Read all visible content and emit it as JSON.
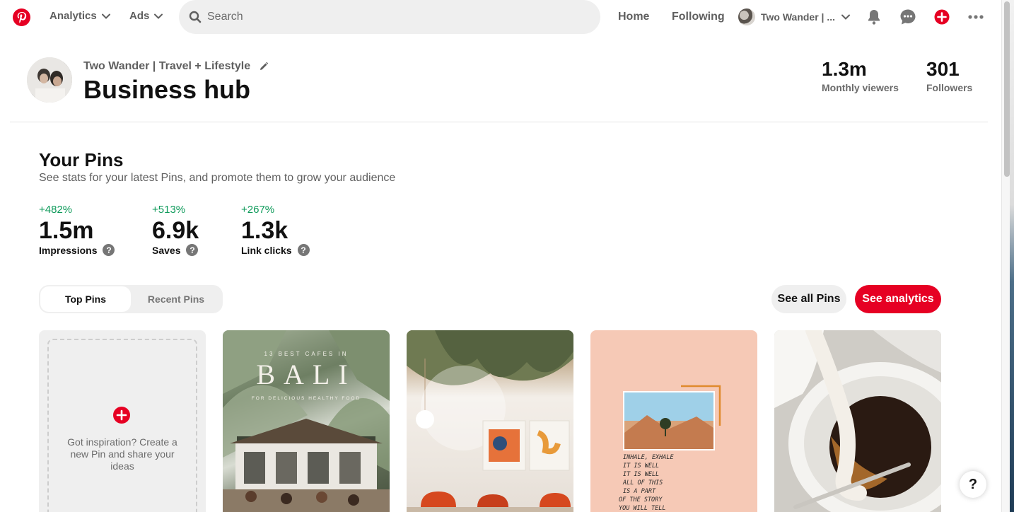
{
  "nav": {
    "analytics_label": "Analytics",
    "ads_label": "Ads",
    "search_placeholder": "Search",
    "home_label": "Home",
    "following_label": "Following",
    "account_label": "Two Wander | ..."
  },
  "header": {
    "profile_name": "Two Wander | Travel + Lifestyle",
    "title": "Business hub",
    "monthly_viewers_value": "1.3m",
    "monthly_viewers_label": "Monthly viewers",
    "followers_value": "301",
    "followers_label": "Followers"
  },
  "your_pins": {
    "title": "Your Pins",
    "subtitle": "See stats for your latest Pins, and promote them to grow your audience",
    "metrics": [
      {
        "change": "+482%",
        "value": "1.5m",
        "label": "Impressions"
      },
      {
        "change": "+513%",
        "value": "6.9k",
        "label": "Saves"
      },
      {
        "change": "+267%",
        "value": "1.3k",
        "label": "Link clicks"
      }
    ],
    "tabs": [
      {
        "label": "Top Pins",
        "active": true
      },
      {
        "label": "Recent Pins",
        "active": false
      }
    ],
    "see_all_label": "See all Pins",
    "see_analytics_label": "See analytics",
    "create_card_text": "Got inspiration? Create a new Pin and share your ideas",
    "pins": {
      "bali_top": "13 BEST CAFES IN",
      "bali_title": "BALI",
      "bali_sub": "FOR DELICIOUS HEALTHY FOOD",
      "quote_lines": [
        "INHALE, EXHALE",
        "IT IS WELL",
        "IT IS WELL",
        "ALL OF THIS",
        "IS A PART",
        "OF THE STORY",
        "YOU WILL TELL"
      ]
    }
  },
  "help_label": "?",
  "colors": {
    "brand_red": "#e60023",
    "positive_green": "#0e9a5a"
  },
  "icons": [
    "pinterest-logo-icon",
    "chevron-down-icon",
    "search-icon",
    "bell-icon",
    "chat-icon",
    "plus-icon",
    "more-icon",
    "pencil-icon",
    "question-icon"
  ]
}
